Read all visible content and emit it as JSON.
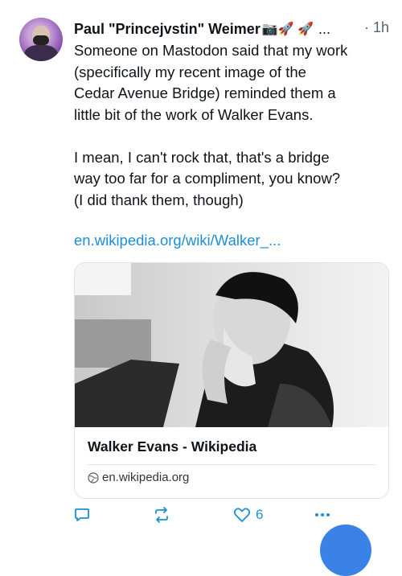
{
  "post": {
    "author": "Paul \"Princejvstin\" Weimer",
    "author_emojis": "📷🚀 🚀",
    "ellipsis": "...",
    "timestamp": "· 1h",
    "text": "Someone on Mastodon said that my work\n(specifically my recent image of the\nCedar Avenue Bridge) reminded them a\nlittle bit of the work of Walker Evans.\n\nI mean, I can't rock that, that's a bridge\nway too far for a compliment, you know?\n(I did thank them, though)",
    "link_text": "en.wikipedia.org/wiki/Walker_...",
    "card": {
      "title": "Walker Evans - Wikipedia",
      "domain": "en.wikipedia.org"
    },
    "actions": {
      "reply_icon": "speech-bubble-icon",
      "repost_icon": "repost-icon",
      "like_icon": "heart-icon",
      "like_count": "6",
      "more_icon": "more-dots-icon"
    }
  },
  "colors": {
    "accent": "#1d8ed8",
    "muted": "#536471",
    "fab": "#3b82e6"
  }
}
